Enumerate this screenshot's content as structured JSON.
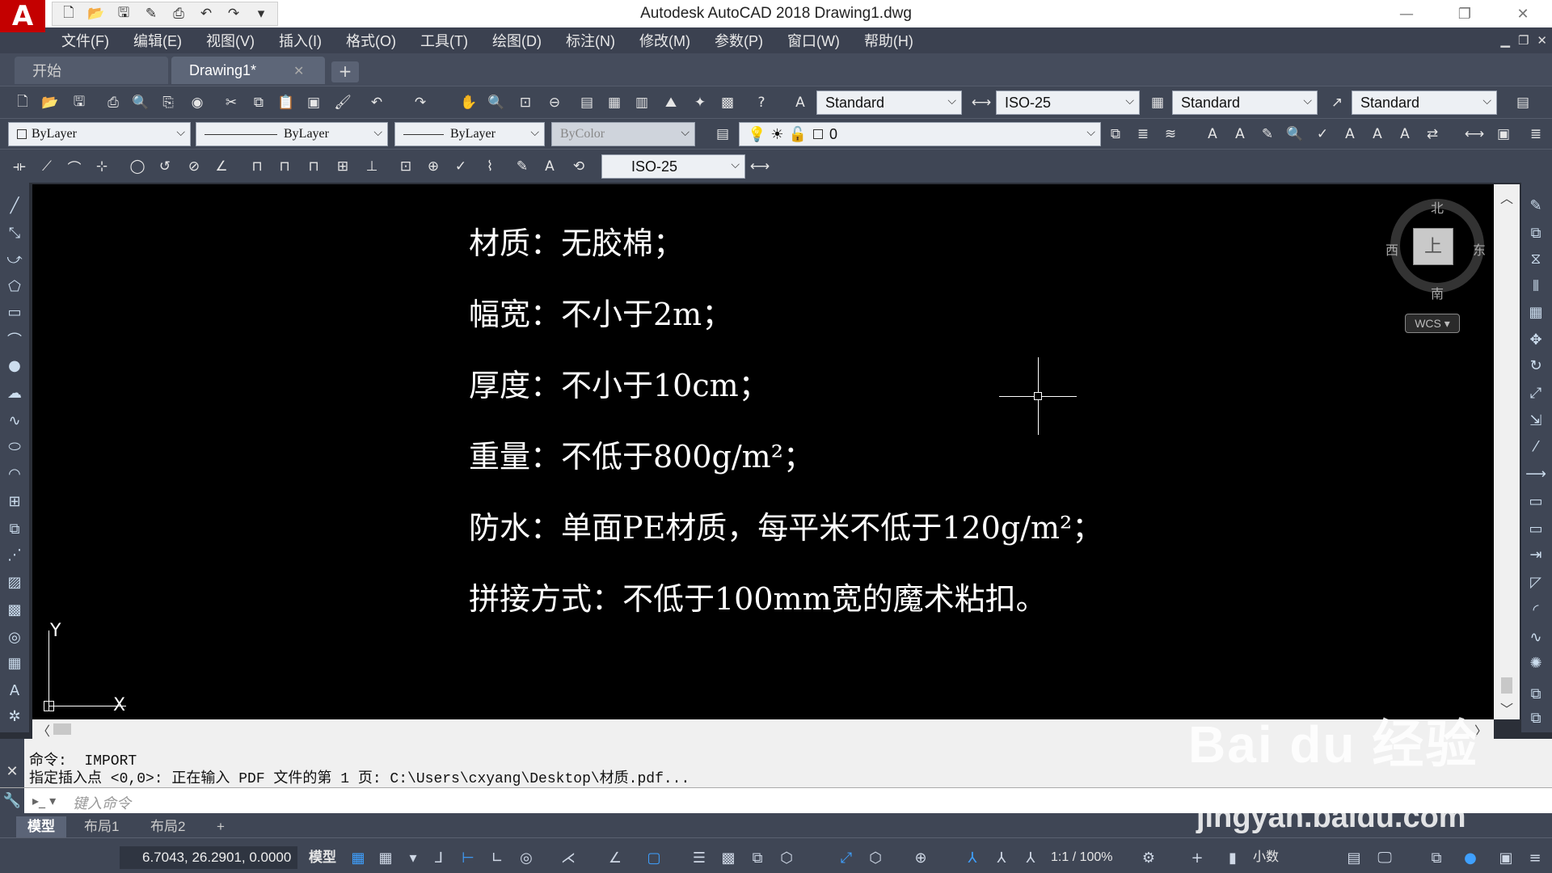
{
  "app": {
    "logo_letter": "A",
    "window_title": "Autodesk AutoCAD 2018    Drawing1.dwg"
  },
  "menu": [
    "文件(F)",
    "编辑(E)",
    "视图(V)",
    "插入(I)",
    "格式(O)",
    "工具(T)",
    "绘图(D)",
    "标注(N)",
    "修改(M)",
    "参数(P)",
    "窗口(W)",
    "帮助(H)"
  ],
  "doc_tabs": [
    {
      "label": "开始",
      "active": false
    },
    {
      "label": "Drawing1*",
      "active": true
    }
  ],
  "styles_toolbar": {
    "text_style": "Standard",
    "dim_style": "ISO-25",
    "table_style": "Standard",
    "multileader_style": "Standard"
  },
  "properties_toolbar": {
    "color": "ByLayer",
    "linetype": "ByLayer",
    "lineweight": "ByLayer",
    "plot_style": "ByColor",
    "layer": "0"
  },
  "dim_toolbar": {
    "dim_style": "ISO-25"
  },
  "drawing_text": [
    "材质：无胶棉；",
    "幅宽：不小于2m；",
    "厚度：不小于10cm；",
    "重量：不低于800g/m²；",
    "防水：单面PE材质，每平米不低于120g/m²；",
    "拼接方式：不低于100mm宽的魔术粘扣。"
  ],
  "viewcube": {
    "north": "北",
    "south": "南",
    "east": "东",
    "west": "西",
    "face": "上",
    "wcs": "WCS"
  },
  "ucs": {
    "x": "X",
    "y": "Y"
  },
  "command": {
    "history": [
      "命令:  IMPORT",
      "指定插入点 <0,0>: 正在输入 PDF 文件的第 1 页: C:\\Users\\cxyang\\Desktop\\材质.pdf..."
    ],
    "placeholder": "键入命令"
  },
  "layout_tabs": [
    {
      "label": "模型",
      "active": true
    },
    {
      "label": "布局1",
      "active": false
    },
    {
      "label": "布局2",
      "active": false
    }
  ],
  "status": {
    "coordinates": "6.7043, 26.2901, 0.0000",
    "model": "模型",
    "scale": "1:1 / 100%",
    "units": "小数"
  },
  "watermark": {
    "brand": "Bai du 经验",
    "url": "jingyan.baidu.com"
  },
  "colors": {
    "canvas": "#000000",
    "chrome": "#3f4655",
    "logo": "#c40000"
  }
}
